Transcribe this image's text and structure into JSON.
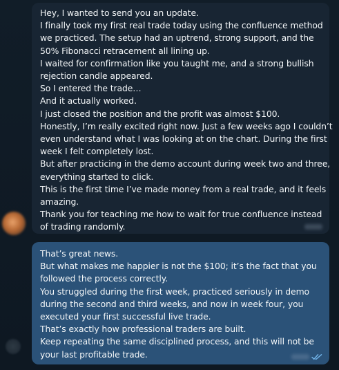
{
  "incoming_message": {
    "lines": [
      "Hey, I wanted to send you an update.",
      "I finally took my first real trade today using the confluence method",
      "we practiced. The setup had an uptrend, strong support, and the",
      "50% Fibonacci retracement all lining up.",
      "I waited for confirmation like you taught me, and a strong bullish",
      "rejection candle appeared.",
      "So I entered the trade…",
      "And it actually worked.",
      "I just closed the position and the profit was almost $100.",
      "Honestly, I’m really excited right now. Just a few weeks ago I couldn’t",
      "even understand what I was looking at on the chart. During the first",
      "week I felt completely lost.",
      "But after practicing in the demo account during week two and three,",
      "everything started to click.",
      "This is the first time I’ve made money from a real trade, and it feels",
      "amazing.",
      "Thank you for teaching me how to wait for true confluence instead",
      "of trading randomly."
    ]
  },
  "outgoing_message": {
    "lines": [
      "That’s great news.",
      "But what makes me happier is not the $100; it’s the fact that you",
      "followed the process correctly.",
      "You struggled during the first week, practiced seriously in demo",
      "during the second and third weeks, and now in week four, you",
      "executed your first successful live trade.",
      "That’s exactly how professional traders are built.",
      "Keep repeating the same disciplined process, and this will not be",
      "your last profitable trade."
    ],
    "status_icon": "double-check-icon",
    "status_color": "#6fb1e6"
  },
  "colors": {
    "incoming_bubble": "#182533",
    "outgoing_bubble": "#2b5278",
    "background": "#0f1a24",
    "text": "#f2f5f7"
  }
}
